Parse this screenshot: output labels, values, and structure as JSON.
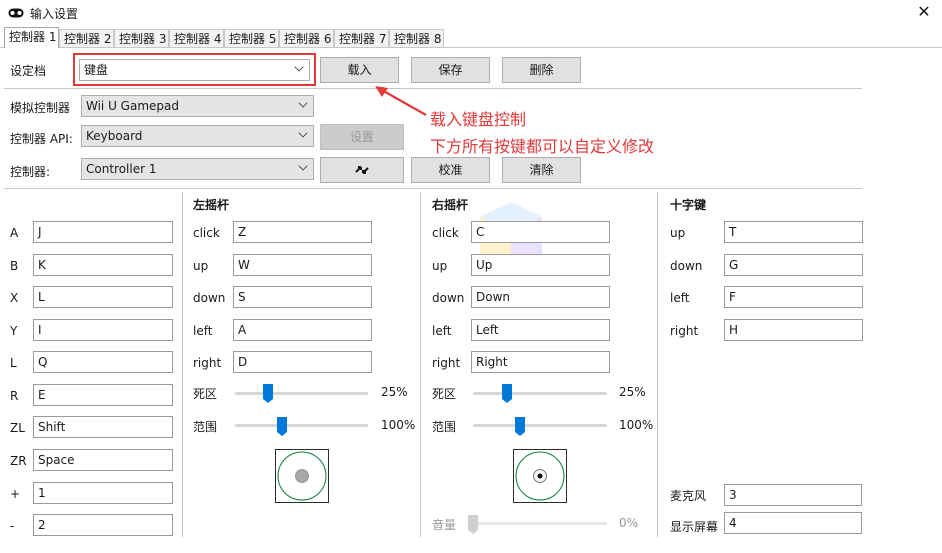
{
  "window": {
    "title": "输入设置",
    "close_glyph": "✕"
  },
  "tabs": [
    "控制器 1",
    "控制器 2",
    "控制器 3",
    "控制器 4",
    "控制器 5",
    "控制器 6",
    "控制器 7",
    "控制器 8"
  ],
  "profile": {
    "label": "设定档",
    "value": "键盘",
    "load": "载入",
    "save": "保存",
    "delete": "删除"
  },
  "emulated": {
    "label": "模拟控制器",
    "value": "Wii U Gamepad"
  },
  "api": {
    "label": "控制器 API:",
    "value": "Keyboard",
    "settings": "设置"
  },
  "controller": {
    "label": "控制器:",
    "value": "Controller 1",
    "calibrate": "校准",
    "clear": "清除"
  },
  "annotation": {
    "line1": "载入键盘控制",
    "line2": "下方所有按键都可以自定义修改",
    "color": "#e23a3a"
  },
  "buttons": [
    {
      "label": "A",
      "value": "J"
    },
    {
      "label": "B",
      "value": "K"
    },
    {
      "label": "X",
      "value": "L"
    },
    {
      "label": "Y",
      "value": "I"
    },
    {
      "label": "L",
      "value": "Q"
    },
    {
      "label": "R",
      "value": "E"
    },
    {
      "label": "ZL",
      "value": "Shift"
    },
    {
      "label": "ZR",
      "value": "Space"
    },
    {
      "label": "+",
      "value": "1"
    },
    {
      "label": "-",
      "value": "2"
    }
  ],
  "left_stick": {
    "title": "左摇杆",
    "rows": [
      {
        "label": "click",
        "value": "Z"
      },
      {
        "label": "up",
        "value": "W"
      },
      {
        "label": "down",
        "value": "S"
      },
      {
        "label": "left",
        "value": "A"
      },
      {
        "label": "right",
        "value": "D"
      }
    ],
    "deadzone": {
      "label": "死区",
      "value": "25%",
      "level": 0.25
    },
    "range": {
      "label": "范围",
      "value": "100%",
      "level": 0.35
    }
  },
  "right_stick": {
    "title": "右摇杆",
    "rows": [
      {
        "label": "click",
        "value": "C"
      },
      {
        "label": "up",
        "value": "Up"
      },
      {
        "label": "down",
        "value": "Down"
      },
      {
        "label": "left",
        "value": "Left"
      },
      {
        "label": "right",
        "value": "Right"
      }
    ],
    "deadzone": {
      "label": "死区",
      "value": "25%",
      "level": 0.25
    },
    "range": {
      "label": "范围",
      "value": "100%",
      "level": 0.35
    },
    "volume": {
      "label": "音量",
      "value": "0%",
      "level": 0
    }
  },
  "dpad": {
    "title": "十字键",
    "rows": [
      {
        "label": "up",
        "value": "T"
      },
      {
        "label": "down",
        "value": "G"
      },
      {
        "label": "left",
        "value": "F"
      },
      {
        "label": "right",
        "value": "H"
      }
    ]
  },
  "extra": {
    "mic": {
      "label": "麦克风",
      "value": "3"
    },
    "screen": {
      "label": "显示屏幕",
      "value": "4"
    }
  },
  "colors": {
    "accent": "#0078d7",
    "annotation": "#e23a3a"
  }
}
